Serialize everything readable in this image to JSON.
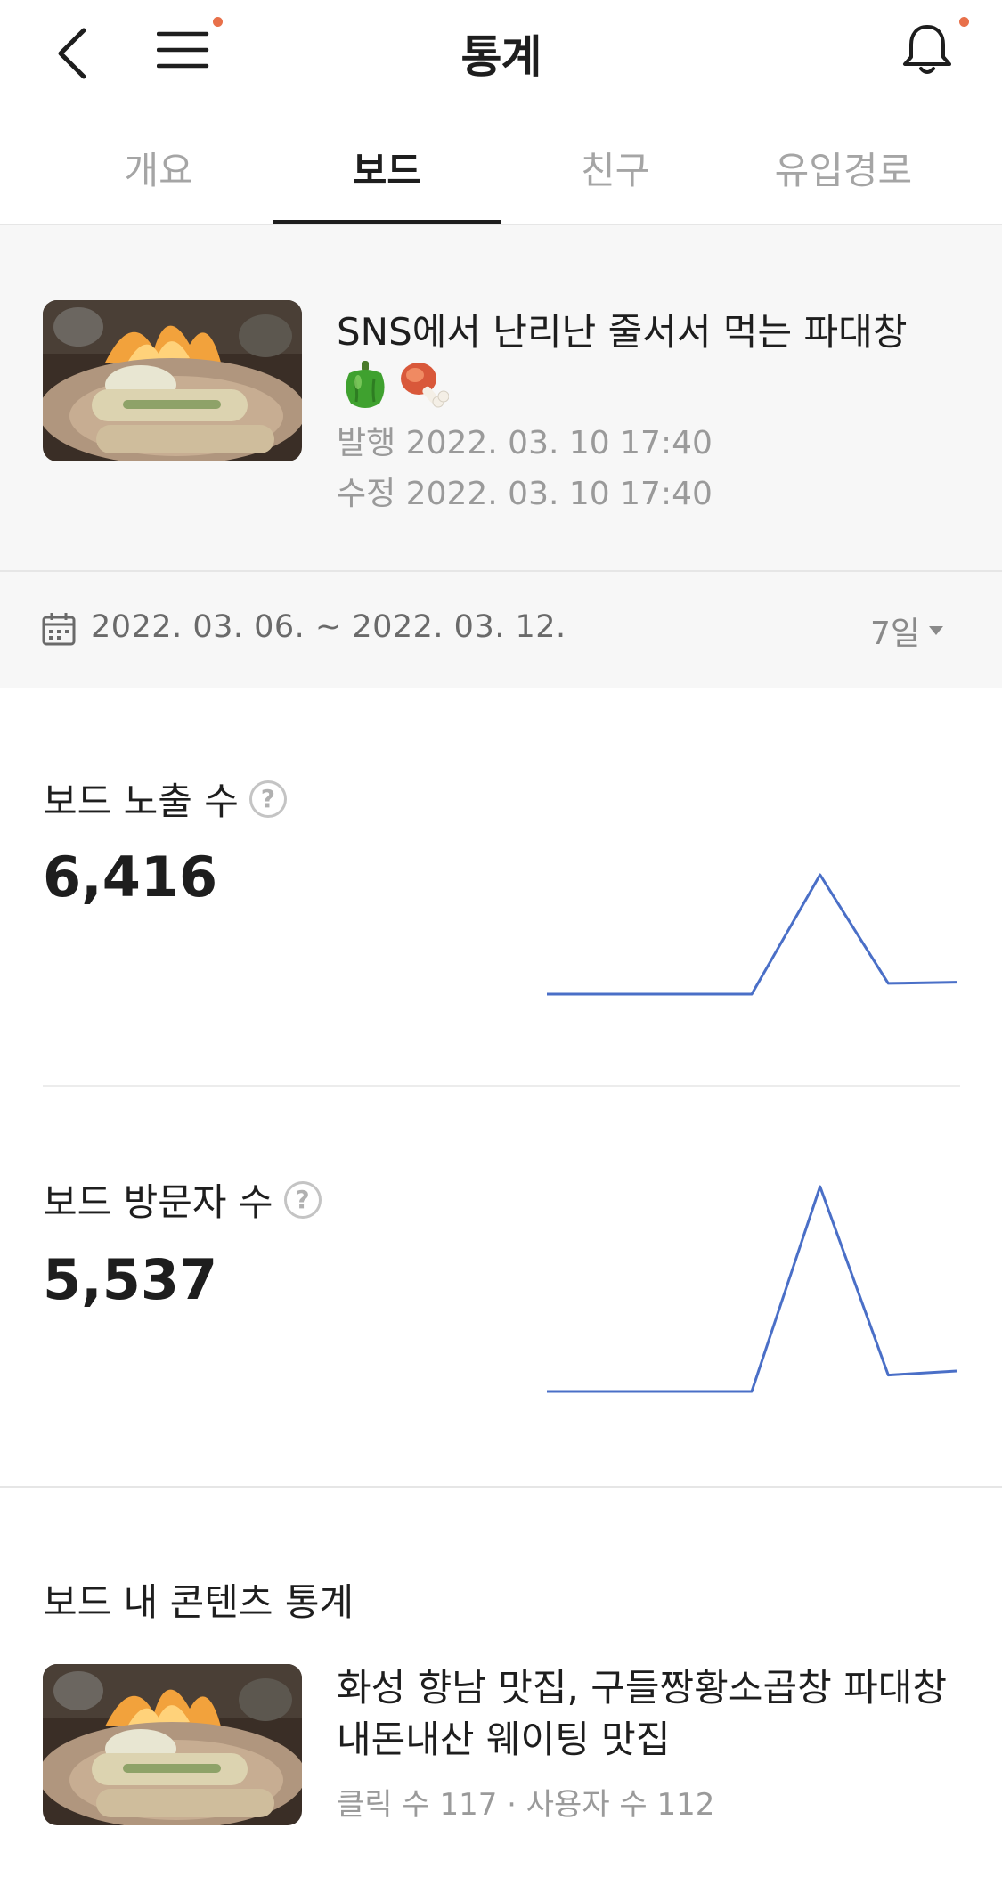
{
  "header": {
    "title": "통계",
    "accent_color": "#e8704a"
  },
  "tabs": [
    {
      "label": "개요",
      "active": false
    },
    {
      "label": "보드",
      "active": true
    },
    {
      "label": "친구",
      "active": false
    },
    {
      "label": "유입경로",
      "active": false
    }
  ],
  "post": {
    "title": "SNS에서 난리난 줄서서 먹는 파대창",
    "emoji_icons": [
      "bell-pepper-icon",
      "meat-on-bone-icon"
    ],
    "published": "발행 2022. 03. 10 17:40",
    "modified": "수정 2022. 03. 10 17:40"
  },
  "date_bar": {
    "range": "2022. 03. 06. ~ 2022. 03. 12.",
    "period": "7일"
  },
  "stats": [
    {
      "label": "보드 노출 수",
      "value": "6,416"
    },
    {
      "label": "보드 방문자 수",
      "value": "5,537"
    }
  ],
  "chart_data": [
    {
      "type": "line",
      "series": [
        {
          "values": [
            0,
            0,
            0,
            0,
            100,
            9,
            10
          ]
        }
      ],
      "color": "#4a6fc7",
      "grid": false
    },
    {
      "type": "line",
      "series": [
        {
          "values": [
            0,
            0,
            0,
            0,
            100,
            8,
            10
          ]
        }
      ],
      "color": "#4a6fc7",
      "grid": false
    }
  ],
  "content_section": {
    "title": "보드 내 콘텐츠 통계",
    "items": [
      {
        "title": "화성 향남 맛집, 구들짱황소곱창 파대창 내돈내산 웨이팅 맛집",
        "meta": "클릭 수 117 · 사용자 수 112"
      }
    ]
  }
}
